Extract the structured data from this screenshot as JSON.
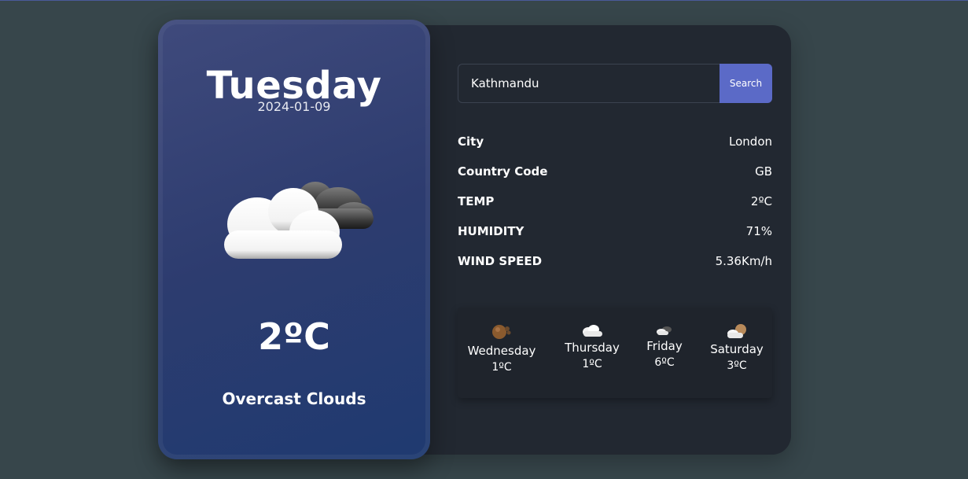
{
  "today": {
    "day": "Tuesday",
    "date": "2024-01-09",
    "icon": "overcast-clouds-icon",
    "temp": "2ºC",
    "description": "Overcast Clouds"
  },
  "search": {
    "value": "Kathmandu",
    "button_label": "Search"
  },
  "details": [
    {
      "label": "City",
      "value": "London"
    },
    {
      "label": "Country Code",
      "value": "GB"
    },
    {
      "label": "TEMP",
      "value": "2ºC"
    },
    {
      "label": "HUMIDITY",
      "value": "71%"
    },
    {
      "label": "WIND SPEED",
      "value": "5.36Km/h"
    }
  ],
  "forecast": [
    {
      "day": "Wednesday",
      "temp": "1ºC",
      "icon": "night-cloudy-icon"
    },
    {
      "day": "Thursday",
      "temp": "1ºC",
      "icon": "cloud-icon"
    },
    {
      "day": "Friday",
      "temp": "6ºC",
      "icon": "partly-cloudy-icon"
    },
    {
      "day": "Saturday",
      "temp": "3ºC",
      "icon": "cloud-sun-icon"
    }
  ],
  "colors": {
    "background": "#37464b",
    "panel": "#222831",
    "accent": "#5b6ac7",
    "card_gradient_start": "#3f4a7c",
    "card_gradient_end": "#1f3a70"
  }
}
